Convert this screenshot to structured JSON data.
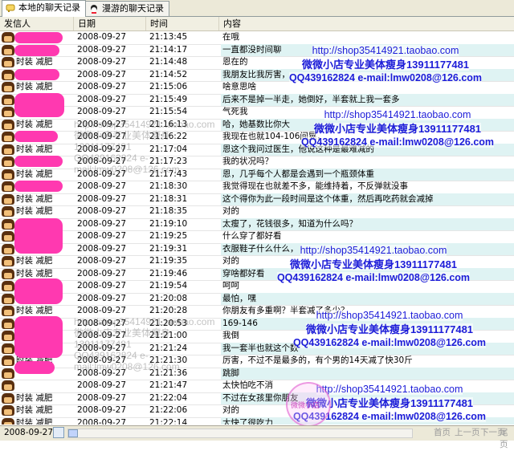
{
  "tabs": [
    {
      "label": "本地的聊天记录",
      "active": true
    },
    {
      "label": "漫游的聊天记录",
      "active": false
    }
  ],
  "columns": {
    "sender": "发信人",
    "date": "日期",
    "time": "时间",
    "content": "内容"
  },
  "rows": [
    {
      "sender": "",
      "date": "2008-09-27",
      "time": "21:13:45",
      "content": "在哦"
    },
    {
      "sender": "",
      "date": "2008-09-27",
      "time": "21:14:17",
      "content": "一直都没时间聊"
    },
    {
      "sender": "时装 减肥",
      "date": "2008-09-27",
      "time": "21:14:48",
      "content": "恩在的"
    },
    {
      "sender": "",
      "date": "2008-09-27",
      "time": "21:14:52",
      "content": "我朋友比我厉害，"
    },
    {
      "sender": "时装 减肥",
      "date": "2008-09-27",
      "time": "21:15:06",
      "content": "啥意思啥"
    },
    {
      "sender": "",
      "date": "2008-09-27",
      "time": "21:15:49",
      "content": "后来不是掉一半走，她倒好，半套就上我一套多"
    },
    {
      "sender": "",
      "date": "2008-09-27",
      "time": "21:15:54",
      "content": "气死我"
    },
    {
      "sender": "时装 减肥",
      "date": "2008-09-27",
      "time": "21:16:13",
      "content": "哈，她基数比你大"
    },
    {
      "sender": "",
      "date": "2008-09-27",
      "time": "21:16:22",
      "content": "我现在也就104-106间晃，"
    },
    {
      "sender": "时装 减肥",
      "date": "2008-09-27",
      "time": "21:17:04",
      "content": "恩这个我问过医生，他说这种是最难减的"
    },
    {
      "sender": "",
      "date": "2008-09-27",
      "time": "21:17:23",
      "content": "我的状况吗？"
    },
    {
      "sender": "时装 减肥",
      "date": "2008-09-27",
      "time": "21:17:43",
      "content": "恩，几乎每个人都是会遇到一个瓶颈体重"
    },
    {
      "sender": "",
      "date": "2008-09-27",
      "time": "21:18:30",
      "content": "我觉得现在也就差不多，能维持着，不反弹就没事"
    },
    {
      "sender": "时装 减肥",
      "date": "2008-09-27",
      "time": "21:18:31",
      "content": "这个得你为此一段时间是这个体重，然后再吃药就会减掉"
    },
    {
      "sender": "时装 减肥",
      "date": "2008-09-27",
      "time": "21:18:35",
      "content": "对的"
    },
    {
      "sender": "",
      "date": "2008-09-27",
      "time": "21:19:10",
      "content": "太瘦了，花钱很多，知道为什么吗？"
    },
    {
      "sender": "",
      "date": "2008-09-27",
      "time": "21:19:25",
      "content": "什么穿了都好看"
    },
    {
      "sender": "",
      "date": "2008-09-27",
      "time": "21:19:31",
      "content": "衣服鞋子什么什么，"
    },
    {
      "sender": "时装 减肥",
      "date": "2008-09-27",
      "time": "21:19:35",
      "content": "对的"
    },
    {
      "sender": "时装 减肥",
      "date": "2008-09-27",
      "time": "21:19:46",
      "content": "穿啥都好看"
    },
    {
      "sender": "",
      "date": "2008-09-27",
      "time": "21:19:54",
      "content": "呵呵"
    },
    {
      "sender": "",
      "date": "2008-09-27",
      "time": "21:20:08",
      "content": "最怕，嘿"
    },
    {
      "sender": "时装 减肥",
      "date": "2008-09-27",
      "time": "21:20:28",
      "content": "你朋友有多重啊？半套减了多少？"
    },
    {
      "sender": "",
      "date": "2008-09-27",
      "time": "21:20:53",
      "content": "169-146"
    },
    {
      "sender": "",
      "date": "2008-09-27",
      "time": "21:21:00",
      "content": "我倒"
    },
    {
      "sender": "",
      "date": "2008-09-27",
      "time": "21:21:24",
      "content": "我一套半也就这个数"
    },
    {
      "sender": "时装 减肥",
      "date": "2008-09-27",
      "time": "21:21:30",
      "content": "厉害，不过不是最多的，有个男的14天减了快30斤"
    },
    {
      "sender": "",
      "date": "2008-09-27",
      "time": "21:21:36",
      "content": "跳脚"
    },
    {
      "sender": "",
      "date": "2008-09-27",
      "time": "21:21:47",
      "content": "太快怕吃不消"
    },
    {
      "sender": "时装 减肥",
      "date": "2008-09-27",
      "time": "21:22:04",
      "content": "不过在女孩里你朋友"
    },
    {
      "sender": "时装 减肥",
      "date": "2008-09-27",
      "time": "21:22:06",
      "content": "对的"
    },
    {
      "sender": "时装 减肥",
      "date": "2008-09-27",
      "time": "21:22:14",
      "content": "太快了很吃力"
    }
  ],
  "ad": {
    "url": "http://shop35414921.taobao.com",
    "line2": "微微小店专业美体瘦身13911177481",
    "line3": "QQ439162824  e-mail:lmw0208@126.com"
  },
  "status": {
    "date": "2008-09-27",
    "first": "首页",
    "prev": "上一页",
    "next": "下一页",
    "last": "尾页"
  },
  "colors": {
    "ad_text": "#1c1cd8",
    "highlight": "#dff3f3",
    "privacy_blob": "#ff39b0"
  },
  "icons": {
    "tab1": "chat-icon",
    "tab2": "roaming-icon",
    "calendar": "calendar-icon"
  }
}
